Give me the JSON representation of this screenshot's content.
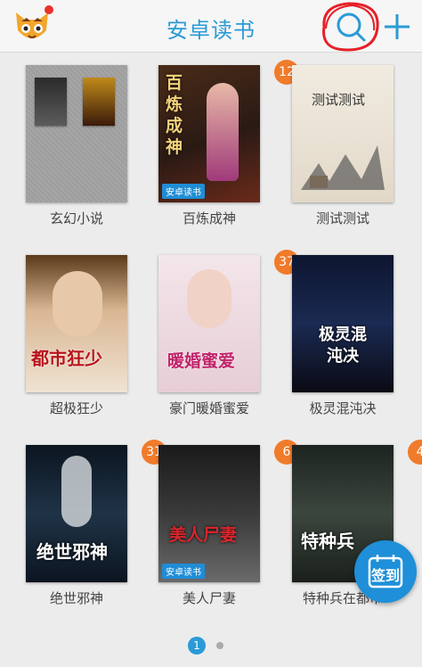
{
  "header": {
    "title": "安卓读书",
    "avatar_icon": "cat-avatar-icon",
    "search_icon": "search-icon",
    "add_icon": "plus-icon"
  },
  "shelf": {
    "items": [
      {
        "title": "玄幻小说",
        "badge": ""
      },
      {
        "title": "百炼成神",
        "badge": "12"
      },
      {
        "title": "测试测试",
        "badge": ""
      },
      {
        "title": "超极狂少",
        "badge": ""
      },
      {
        "title": "豪门暖婚蜜爱",
        "badge": "37"
      },
      {
        "title": "极灵混沌决",
        "badge": ""
      },
      {
        "title": "绝世邪神",
        "badge": "31"
      },
      {
        "title": "美人尸妻",
        "badge": "6"
      },
      {
        "title": "特种兵在都市",
        "badge": "4"
      }
    ],
    "cover_texts": {
      "bailian": "百炼成神",
      "test": "测试测试",
      "chaoji": "都市狂少",
      "haomen": "暖婚蜜爱",
      "jiling": "极灵混沌决",
      "jueshi": "绝世邪神",
      "meiren": "美人尸妻",
      "tezhong": "特种兵"
    },
    "brand": "安卓读书"
  },
  "pager": {
    "current": "1"
  },
  "signin": {
    "label": "签到"
  },
  "colors": {
    "accent": "#2a9bd6",
    "badge": "#f07b2a"
  }
}
